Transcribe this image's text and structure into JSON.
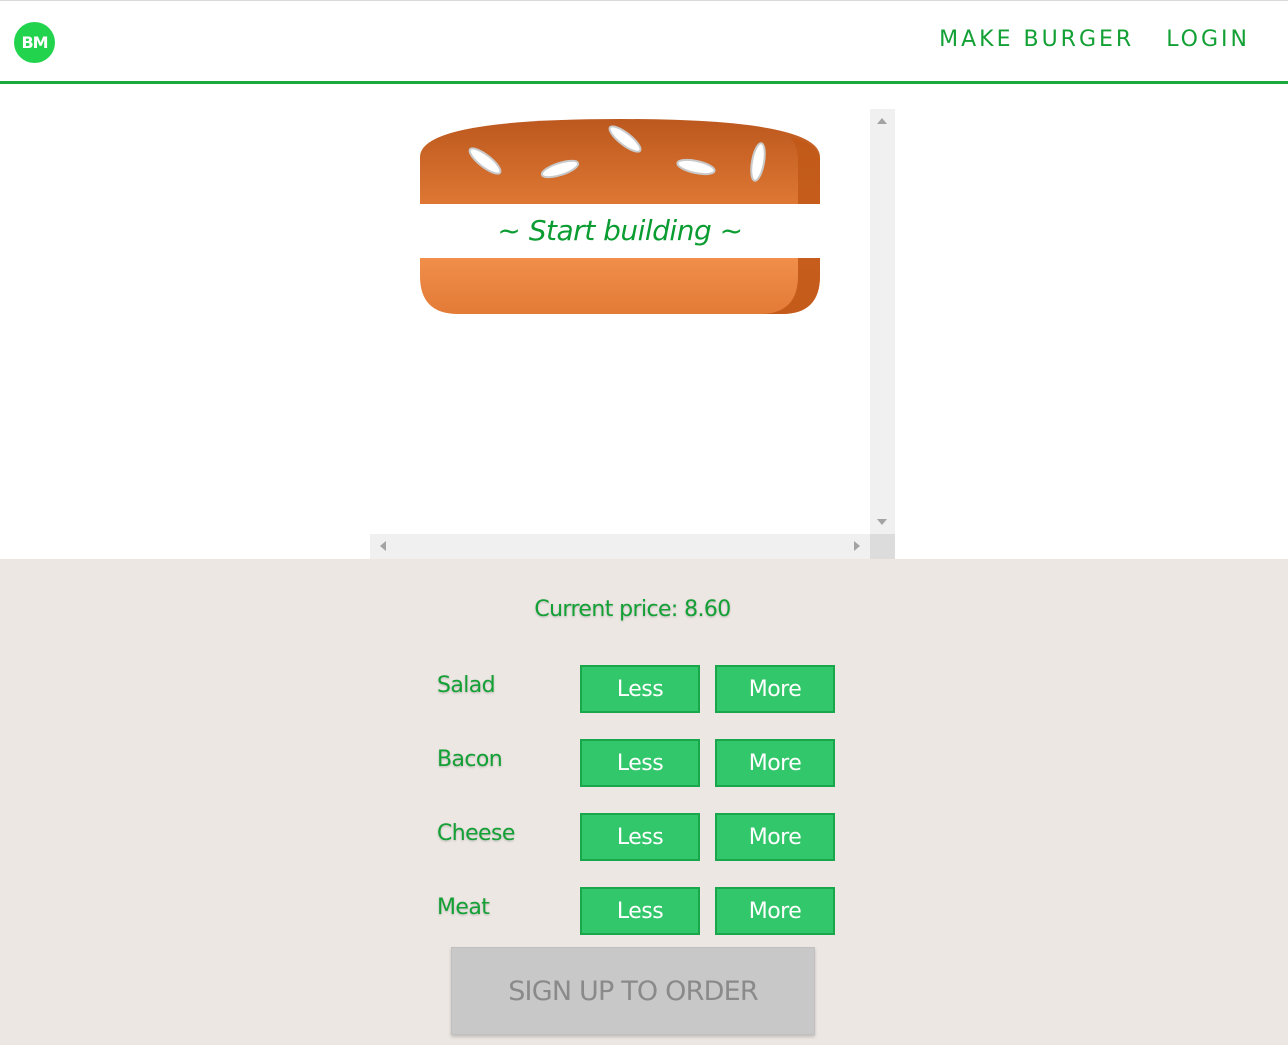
{
  "header": {
    "logo_text": "BM",
    "nav": [
      {
        "label": "MAKE BURGER"
      },
      {
        "label": "LOGIN"
      }
    ]
  },
  "burger": {
    "prompt": "~ Start building ~"
  },
  "build_controls": {
    "price_label": "Current price: 8.60",
    "price": 8.6,
    "ingredients": [
      {
        "label": "Salad",
        "less_label": "Less",
        "more_label": "More"
      },
      {
        "label": "Bacon",
        "less_label": "Less",
        "more_label": "More"
      },
      {
        "label": "Cheese",
        "less_label": "Less",
        "more_label": "More"
      },
      {
        "label": "Meat",
        "less_label": "Less",
        "more_label": "More"
      }
    ],
    "order_button_label": "SIGN UP TO ORDER"
  },
  "colors": {
    "brand_green": "#13a035",
    "button_green": "#33c76b",
    "logo_green": "#22d34e",
    "controls_background": "#ece7e3",
    "disabled_button": "#c8c8c8"
  }
}
